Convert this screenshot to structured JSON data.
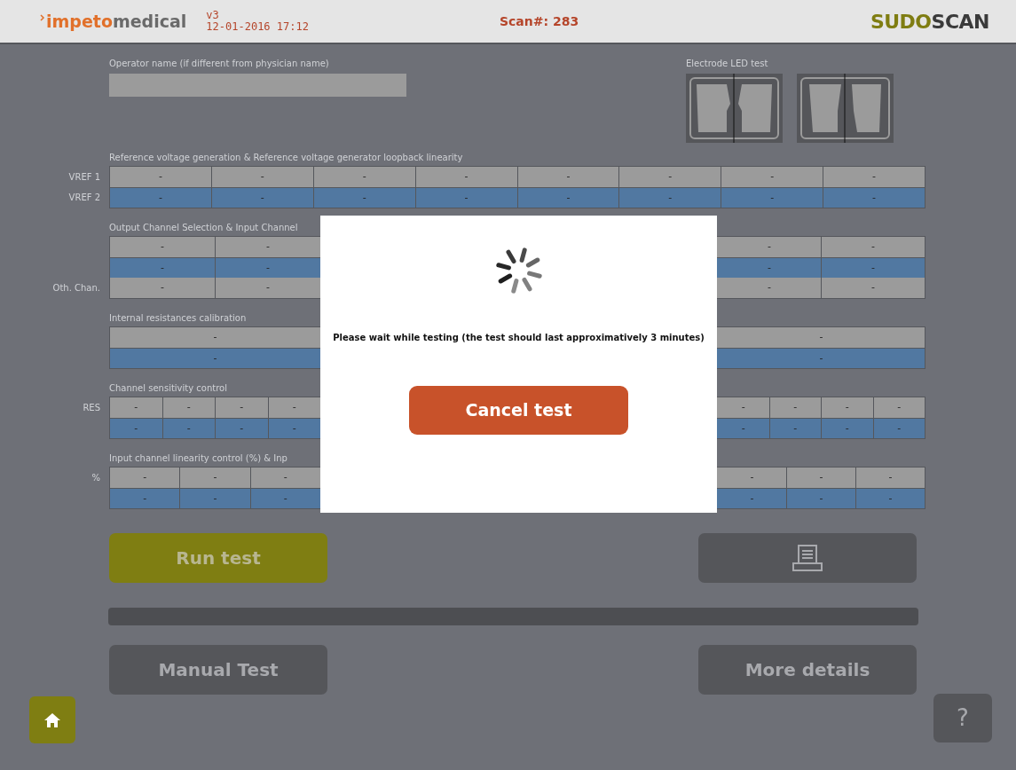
{
  "header": {
    "logo_parts": [
      "impeto",
      "medical"
    ],
    "version": "v3",
    "datetime": "12-01-2016 17:12",
    "scan": "Scan#: 283",
    "brand_parts": [
      "SUDO",
      "SCAN"
    ]
  },
  "operator": {
    "label": "Operator name (if different from physician name)"
  },
  "electrode": {
    "label": "Electrode LED test"
  },
  "sections": [
    {
      "title": "Reference voltage generation & Reference voltage generator loopback linearity",
      "rows": [
        {
          "label": "VREF 1",
          "kind": "plain",
          "cells": [
            "-",
            "-",
            "-",
            "-",
            "-",
            "-",
            "-",
            "-"
          ]
        },
        {
          "label": "VREF 2",
          "kind": "highlight",
          "cells": [
            "-",
            "-",
            "-",
            "-",
            "-",
            "-",
            "-",
            "-"
          ]
        }
      ]
    },
    {
      "title": "Output Channel Selection & Input Channel",
      "rows": [
        {
          "kind": "plain",
          "cells_left": [
            "-",
            "-"
          ],
          "cells_right": [
            "-",
            "-"
          ]
        },
        {
          "kind": "highlight",
          "cells_left": [
            "-",
            "-"
          ],
          "cells_right": [
            "-",
            "-"
          ]
        },
        {
          "label": "Oth. Chan.",
          "kind": "plain",
          "cells_left": [
            "-",
            "-"
          ],
          "cells_right": [
            "-",
            "-"
          ]
        }
      ]
    },
    {
      "title": "Internal resistances calibration",
      "rows": [
        {
          "kind": "plain",
          "cells_left": [
            "-"
          ],
          "cells_right": [
            "-"
          ]
        },
        {
          "kind": "highlight",
          "cells_left": [
            "-"
          ],
          "cells_right": [
            "-"
          ]
        }
      ]
    },
    {
      "title": "Channel sensitivity control",
      "rows": [
        {
          "label": "RES",
          "kind": "plain",
          "cells_left": [
            "-",
            "-",
            "-",
            "-"
          ],
          "cells_right": [
            "-",
            "-",
            "-",
            "-"
          ]
        },
        {
          "kind": "highlight",
          "cells_left": [
            "-",
            "-",
            "-",
            "-"
          ],
          "cells_right": [
            "-",
            "-",
            "-",
            "-"
          ]
        }
      ]
    },
    {
      "title": "Input channel linearity control (%) & Inp",
      "rows": [
        {
          "label": "%",
          "kind": "plain",
          "cells_left": [
            "-",
            "-",
            "-"
          ],
          "cells_right": [
            "-",
            "-",
            "-"
          ]
        },
        {
          "kind": "highlight",
          "cells_left": [
            "-",
            "-",
            "-"
          ],
          "cells_right": [
            "-",
            "-",
            "-"
          ]
        }
      ]
    }
  ],
  "run_button": {
    "label": "Run test",
    "kind": "primary"
  },
  "print_button": {
    "kind": "secondary"
  },
  "progress": {
    "level": 0
  },
  "manual_button": {
    "label": "Manual Test",
    "kind": "secondary"
  },
  "details_button": {
    "label": "More details",
    "kind": "secondary"
  },
  "help_button": {
    "label": "?"
  },
  "modal": {
    "message": "Please wait while testing (the test should last approximatively 3 minutes)",
    "cancel": "Cancel test"
  }
}
